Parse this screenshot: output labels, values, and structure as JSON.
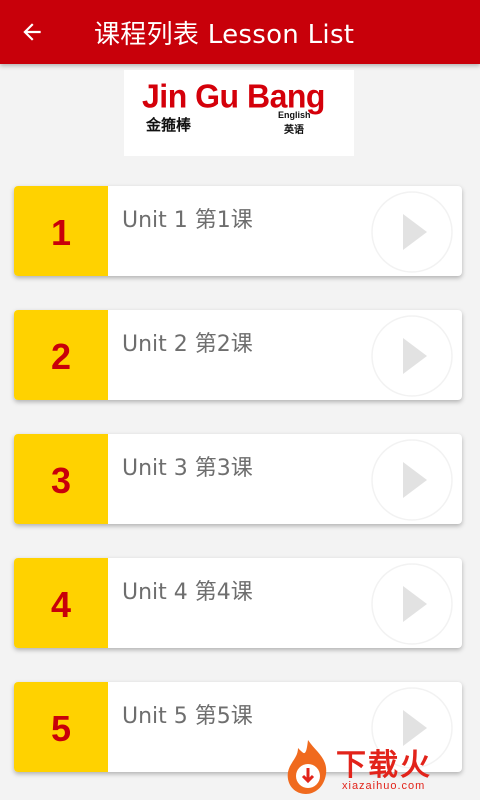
{
  "appbar": {
    "title": "课程列表 Lesson List",
    "back_icon": "arrow-left-icon",
    "color": "#c8000a"
  },
  "logo": {
    "main": "Jin Gu Bang",
    "chinese": "金箍棒",
    "english": "English",
    "chinese_english": "英语"
  },
  "lessons": [
    {
      "number": "1",
      "label": "Unit 1 第1课",
      "icon": "play-icon"
    },
    {
      "number": "2",
      "label": "Unit 2 第2课",
      "icon": "play-icon"
    },
    {
      "number": "3",
      "label": "Unit 3 第3课",
      "icon": "play-icon"
    },
    {
      "number": "4",
      "label": "Unit 4 第4课",
      "icon": "play-icon"
    },
    {
      "number": "5",
      "label": "Unit 5 第5课",
      "icon": "play-icon"
    }
  ],
  "watermark": {
    "brand": "下载火",
    "url": "xiazaihuo.com"
  },
  "colors": {
    "accent": "#c8000a",
    "number_bg": "#ffd200",
    "label_text": "#6e6e6e"
  }
}
